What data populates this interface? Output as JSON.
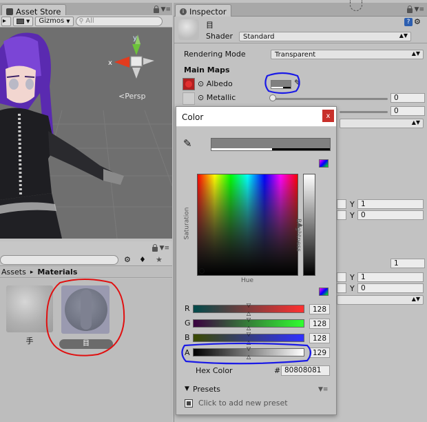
{
  "left_tabs": {
    "asset_store_tab": "Asset Store"
  },
  "scene": {
    "gizmos_label": "Gizmos",
    "search_placeholder": "All",
    "axis_x": "x",
    "axis_y": "y",
    "persp_label": "Persp"
  },
  "project": {
    "breadcrumb_assets": "Assets",
    "breadcrumb_sep": "▸",
    "breadcrumb_materials": "Materials",
    "items": [
      {
        "label": "手"
      },
      {
        "label": "目"
      }
    ]
  },
  "inspector": {
    "tab_label": "Inspector",
    "material_name": "目",
    "shader_label": "Shader",
    "shader_value": "Standard",
    "rendering_mode_label": "Rendering Mode",
    "rendering_mode_value": "Transparent",
    "main_maps_label": "Main Maps",
    "albedo_label": "Albedo",
    "metallic_label": "Metallic",
    "metallic_value": "0",
    "smoothness_value": "0",
    "tiling_y_label": "Y",
    "tiling_y_value": "1",
    "offset_y_label": "Y",
    "offset_y_value": "0",
    "secondary_uv_value": "1",
    "detail_tiling_y_label": "Y",
    "detail_tiling_y_value": "1",
    "detail_offset_y_label": "Y",
    "detail_offset_y_value": "0"
  },
  "color_window": {
    "title": "Color",
    "close_label": "x",
    "saturation_label": "Saturation",
    "hue_label": "Hue",
    "brightness_label": "Brightness",
    "channels": [
      {
        "name": "R",
        "value": "128"
      },
      {
        "name": "G",
        "value": "128"
      },
      {
        "name": "B",
        "value": "128"
      },
      {
        "name": "A",
        "value": "129"
      }
    ],
    "hex_label": "Hex Color",
    "hex_hash": "#",
    "hex_value": "80808081",
    "presets_label": "Presets",
    "add_preset_label": "Click to add new preset"
  },
  "colors": {
    "current_color": "#808080",
    "annotation_blue": "#1a1ae6",
    "annotation_red": "#e01010",
    "close_red": "#c8302b"
  }
}
